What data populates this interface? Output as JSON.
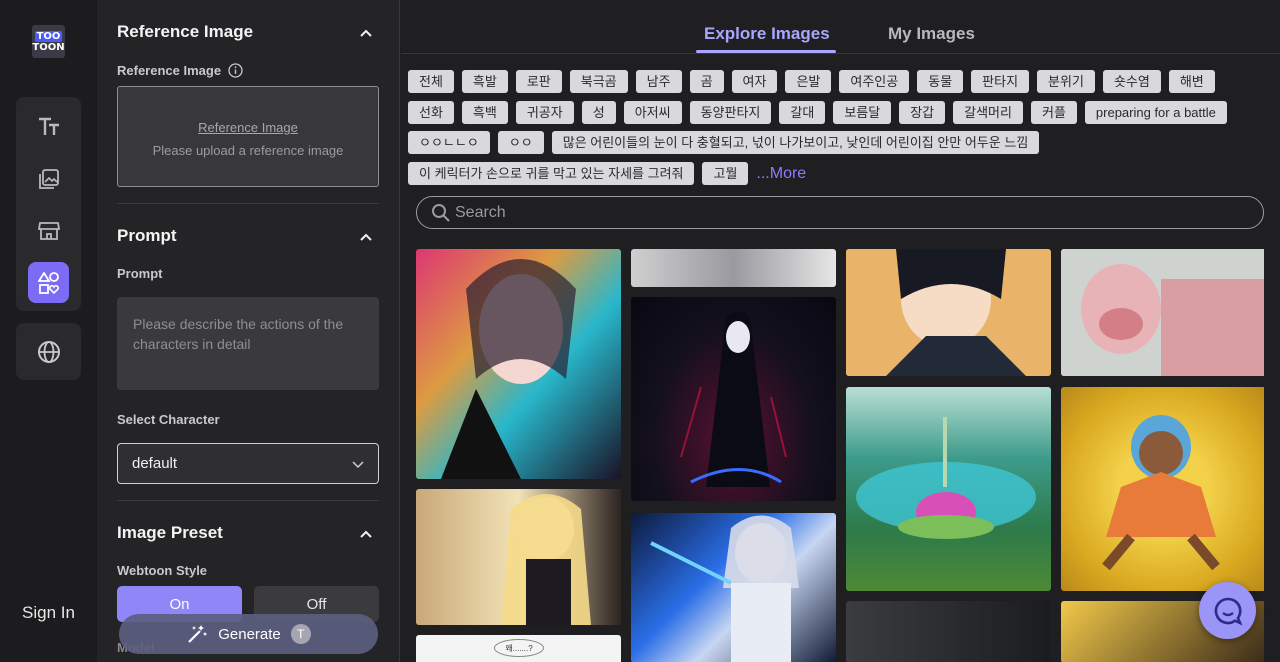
{
  "app": {
    "logo_top": "TOO",
    "logo_bottom": "TOON"
  },
  "rail": {
    "items": [
      {
        "name": "text-icon"
      },
      {
        "name": "gallery-icon"
      },
      {
        "name": "store-icon"
      },
      {
        "name": "shapes-icon",
        "active": true
      }
    ],
    "language_icon": "globe-icon",
    "sign_in": "Sign In"
  },
  "panel": {
    "reference": {
      "title": "Reference Image",
      "label": "Reference Image",
      "upload_link": "Reference Image",
      "upload_hint": "Please upload a reference image"
    },
    "prompt": {
      "title": "Prompt",
      "label": "Prompt",
      "placeholder": "Please describe the actions of the characters in detail"
    },
    "character": {
      "label": "Select Character",
      "value": "default"
    },
    "preset": {
      "title": "Image Preset",
      "webtoon_label": "Webtoon Style",
      "on": "On",
      "off": "Off",
      "model_label": "Model"
    },
    "generate": {
      "label": "Generate",
      "token": "T"
    }
  },
  "explore": {
    "tabs": [
      {
        "label": "Explore Images",
        "active": true
      },
      {
        "label": "My Images",
        "active": false
      }
    ],
    "tag_rows": [
      [
        "전체",
        "흑발",
        "로판",
        "북극곰",
        "남주",
        "곰",
        "여자",
        "은발",
        "여주인공",
        "동물",
        "판타지",
        "분위기",
        "숏수염",
        "해변"
      ],
      [
        "선화",
        "흑백",
        "귀공자",
        "성",
        "아저씨",
        "동양판타지",
        "갈대",
        "보름달",
        "장갑",
        "갈색머리",
        "커플",
        "preparing for a battle"
      ],
      [
        "ㅇㅇㄴㄴㅇ",
        "ㅇㅇ",
        "많은 어린이들의 눈이 다 충혈되고, 넋이 나가보이고, 낮인데 어린이집 안만 어두운 느낌"
      ],
      [
        "이 케릭터가 손으로 귀를 막고 있는 자세를 그려줘",
        "고뭘"
      ]
    ],
    "more": "...More",
    "search_placeholder": "Search",
    "speech_text": "왜.......?"
  },
  "colors": {
    "accent": "#a9a6ff",
    "accent_fill": "#7c6cf5",
    "toggle_on": "#8f86f7"
  }
}
